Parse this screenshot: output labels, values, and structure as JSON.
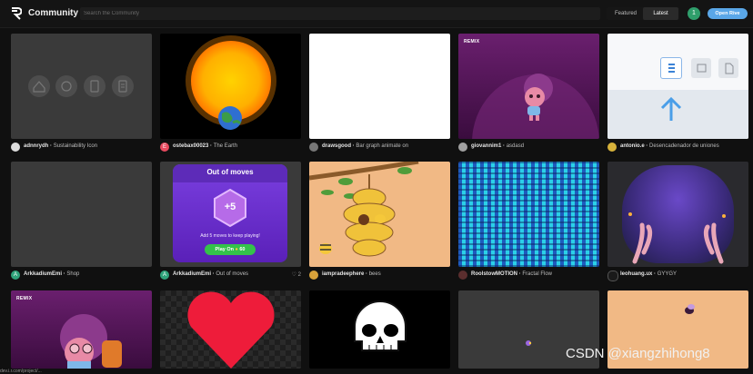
{
  "header": {
    "brand": "Community",
    "search_placeholder": "Search the Community",
    "tabs": [
      "Featured",
      "Latest"
    ],
    "active_tab": "Latest",
    "user_initial": "1",
    "open_button": "Open Rive"
  },
  "cards": [
    {
      "author": "adnnrydh",
      "title": "Sustainability Icon",
      "avatar_color": "#8c8c8c"
    },
    {
      "author": "ostebax00023",
      "title": "The Earth",
      "avatar_color": "#e84a5f",
      "avatar_initial": "E"
    },
    {
      "author": "drawsgood",
      "title": "Bar graph animate on",
      "avatar_color": "#777777"
    },
    {
      "author": "giovannim1",
      "title": "asdasd",
      "avatar_color": "#a0a0a0"
    },
    {
      "author": "antonio.e",
      "title": "Desencadenador de uniones",
      "avatar_color": "#d7b23b"
    },
    {
      "author": "ArkkadiumEmi",
      "title": "Shop",
      "avatar_color": "#2fa37a",
      "avatar_initial": "A"
    },
    {
      "author": "ArkkadiumEmi",
      "title": "Out of moves",
      "avatar_color": "#2fa37a",
      "avatar_initial": "A",
      "likes": "2"
    },
    {
      "author": "iampradeephere",
      "title": "bees",
      "avatar_color": "#d8a23a"
    },
    {
      "author": "RoolstowMOTION",
      "title": "Fractal Flow",
      "avatar_color": "#5b2e2e"
    },
    {
      "author": "leohuang.ux",
      "title": "GYYGY",
      "avatar_color": "#1a1a1a"
    }
  ],
  "thumbs": {
    "remix_label": "REMIX",
    "moves_title": "Out of moves",
    "moves_value": "+5",
    "moves_text": "Add 5 moves to keep playing!",
    "play_label": "Play On",
    "play_cost": "60"
  },
  "watermark": "CSDN @xiangzhihong8",
  "bottom_fragment": "dev.i.r.com/project/..."
}
